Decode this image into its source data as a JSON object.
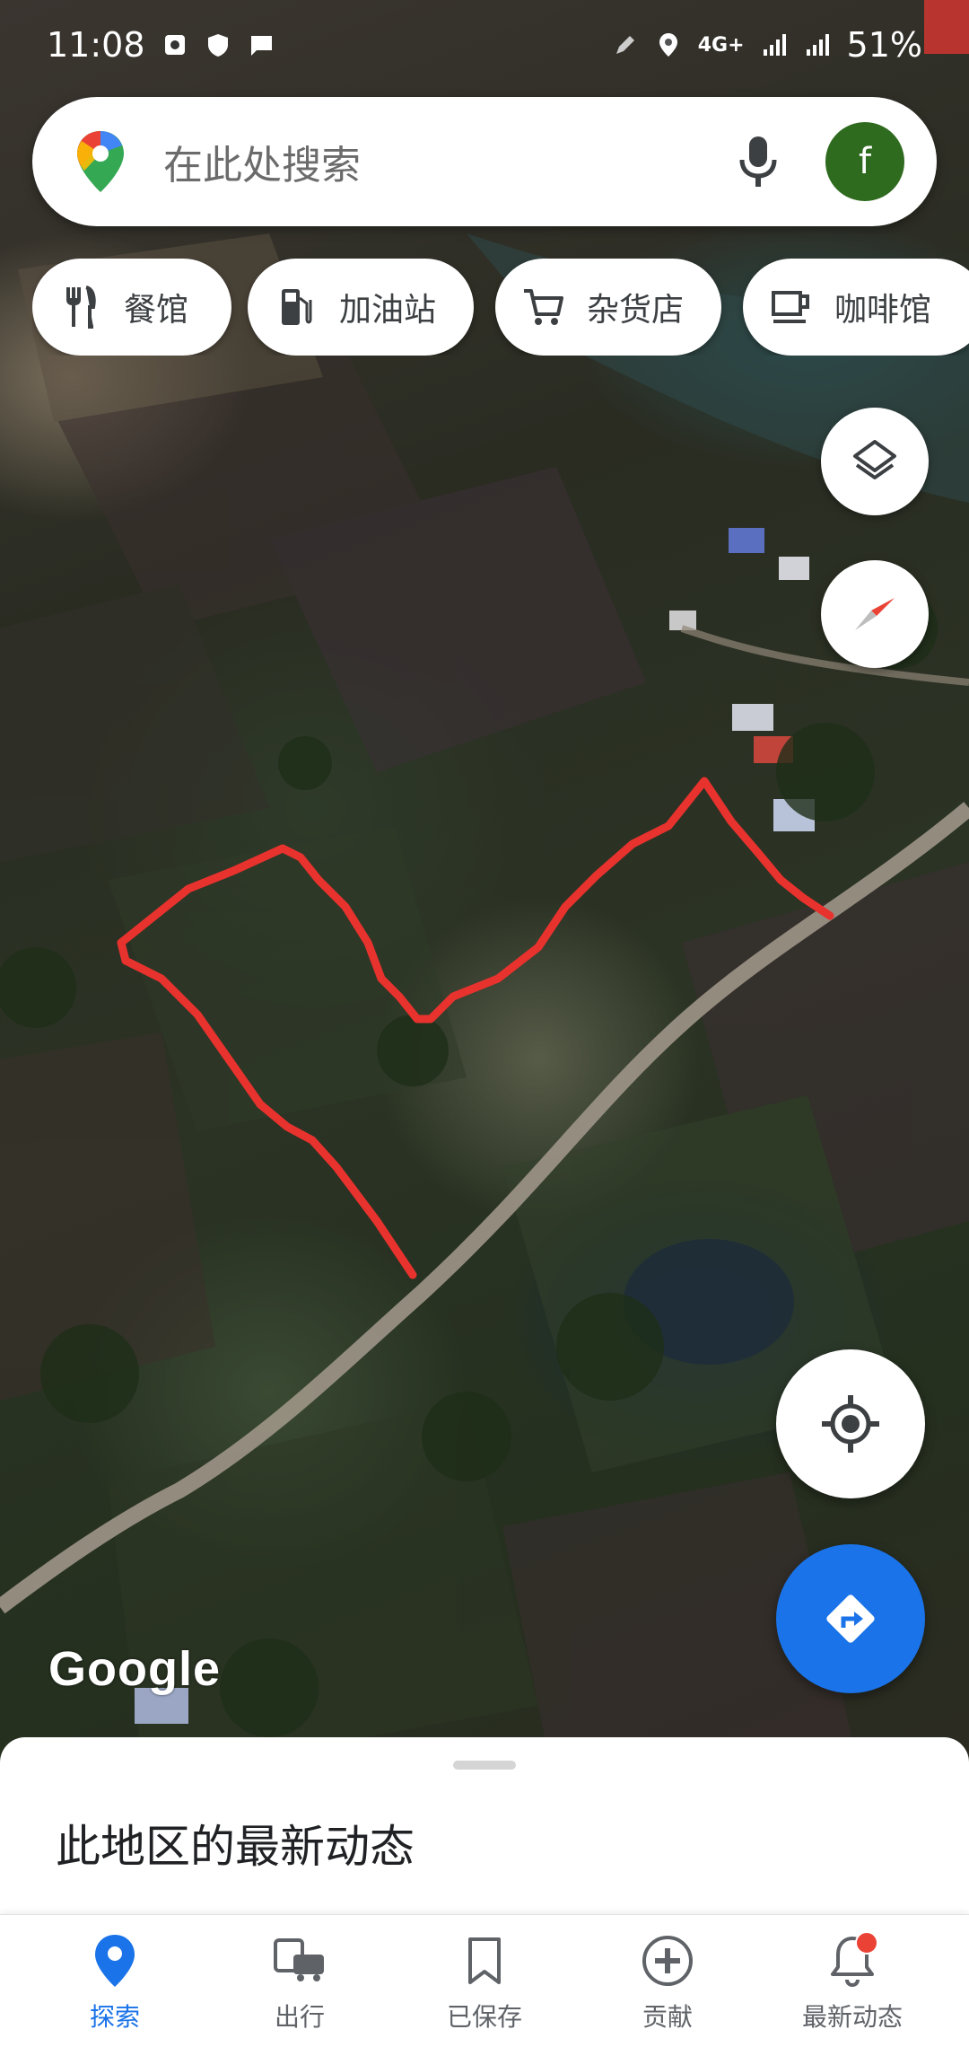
{
  "status_bar": {
    "time": "11:08",
    "network": "4G+",
    "battery": "51%"
  },
  "search": {
    "placeholder": "在此处搜索",
    "avatar_initial": "f",
    "avatar_color": "#2e6b1f"
  },
  "chips": [
    {
      "label": "餐馆",
      "icon": "restaurant-icon"
    },
    {
      "label": "加油站",
      "icon": "gas-station-icon"
    },
    {
      "label": "杂货店",
      "icon": "shopping-cart-icon"
    },
    {
      "label": "咖啡馆",
      "icon": "coffee-icon"
    }
  ],
  "map": {
    "attribution": "Google",
    "annotation_color": "#e8322e"
  },
  "bottom_sheet": {
    "title": "此地区的最新动态"
  },
  "nav": {
    "items": [
      {
        "label": "探索",
        "icon": "explore-pin-icon",
        "active": true
      },
      {
        "label": "出行",
        "icon": "commute-icon",
        "active": false
      },
      {
        "label": "已保存",
        "icon": "bookmark-icon",
        "active": false
      },
      {
        "label": "贡献",
        "icon": "add-circle-icon",
        "active": false
      },
      {
        "label": "最新动态",
        "icon": "bell-icon",
        "active": false,
        "badge": true
      }
    ]
  },
  "colors": {
    "accent": "#1a73e8",
    "badge": "#ea4335"
  }
}
